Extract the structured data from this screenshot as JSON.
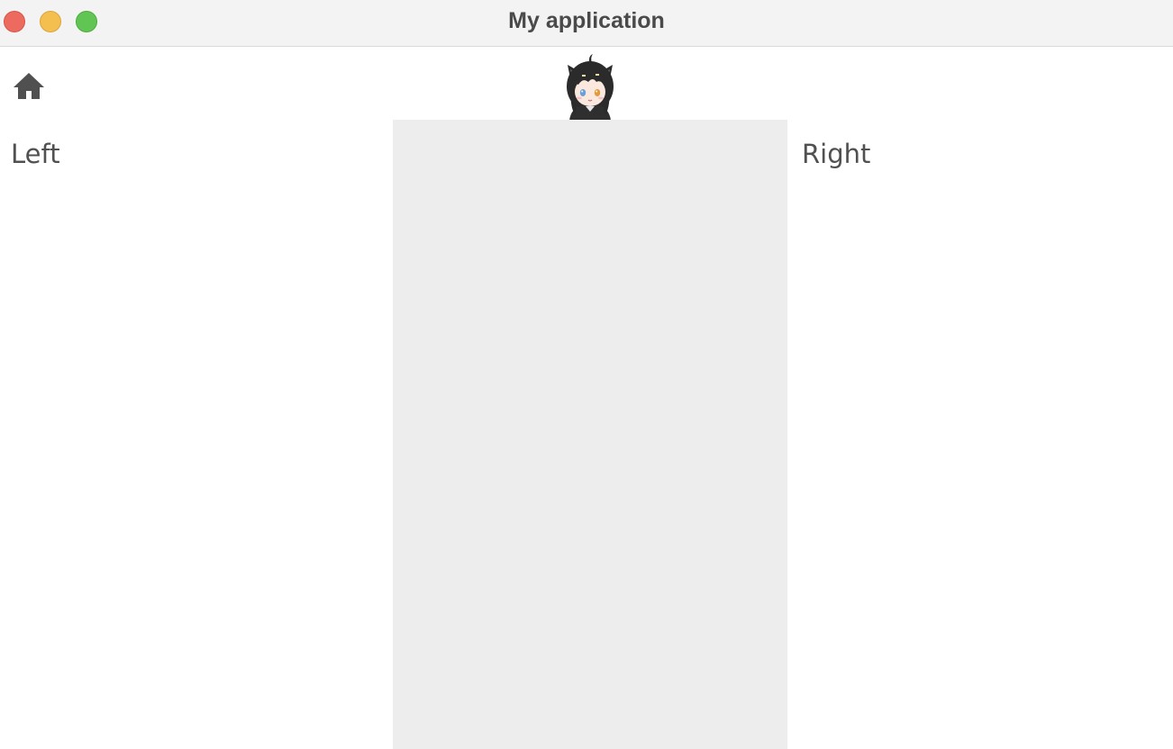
{
  "window": {
    "title": "My application"
  },
  "header": {
    "home_icon": "home-icon",
    "avatar_icon": "avatar-image"
  },
  "panels": {
    "left_label": "Left",
    "right_label": "Right"
  },
  "colors": {
    "titlebar_bg": "#f3f3f3",
    "close": "#ed6a5e",
    "minimize": "#f4bf4f",
    "maximize": "#61c554",
    "center_panel_bg": "#ededed",
    "text": "#505050"
  }
}
